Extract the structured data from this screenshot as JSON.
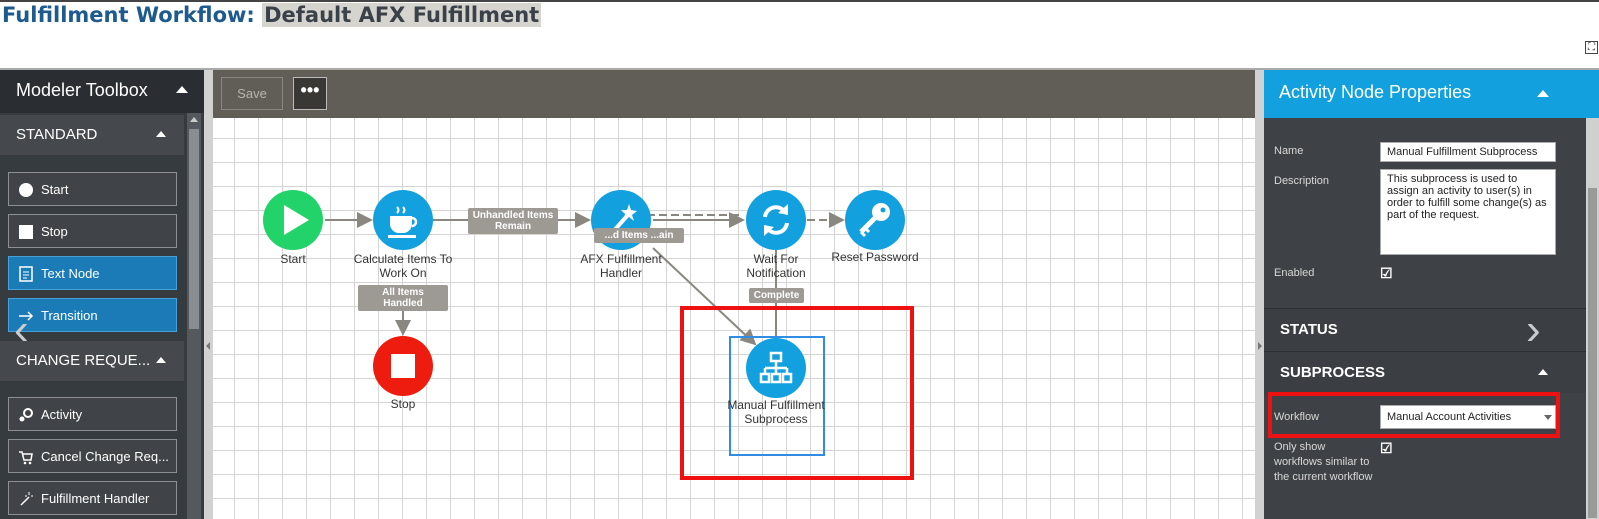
{
  "page": {
    "title_prefix": "Fulfillment Workflow:",
    "workflow_name": "Default AFX Fulfillment",
    "expand_glyph": "⛶"
  },
  "toolbox": {
    "title": "Modeler Toolbox",
    "sections": [
      {
        "label": "STANDARD",
        "items": [
          {
            "label": "Start",
            "icon": "circle-icon"
          },
          {
            "label": "Stop",
            "icon": "square-icon"
          },
          {
            "label": "Text Node",
            "icon": "document-icon"
          },
          {
            "label": "Transition",
            "icon": "arrow-right-icon"
          }
        ]
      },
      {
        "label": "CHANGE REQUE...",
        "items": [
          {
            "label": "Activity",
            "icon": "gears-icon"
          },
          {
            "label": "Cancel Change Req...",
            "icon": "cart-icon"
          },
          {
            "label": "Fulfillment Handler",
            "icon": "wand-icon"
          }
        ]
      }
    ]
  },
  "canvas_toolbar": {
    "save_label": "Save",
    "more_label": "•••"
  },
  "diagram": {
    "nodes": [
      {
        "id": "start",
        "label": "Start",
        "icon": "play-icon",
        "color": "#22d36a"
      },
      {
        "id": "calc",
        "label": "Calculate Items To Work On",
        "icon": "coffee-icon",
        "color": "#13a0df"
      },
      {
        "id": "afx",
        "label": "AFX Fulfillment Handler",
        "icon": "wand-icon",
        "color": "#13a0df"
      },
      {
        "id": "wait",
        "label": "Wait For Notification",
        "icon": "refresh-icon",
        "color": "#13a0df"
      },
      {
        "id": "reset",
        "label": "Reset Password",
        "icon": "key-icon",
        "color": "#13a0df"
      },
      {
        "id": "stop",
        "label": "Stop",
        "icon": "stop-icon",
        "color": "#ee1c0e"
      },
      {
        "id": "manual",
        "label": "Manual Fulfillment Subprocess",
        "icon": "hierarchy-icon",
        "color": "#13a0df"
      }
    ],
    "edge_labels": {
      "unhandled": "Unhandled Items Remain",
      "unhandled_2": "...d Items ...ain",
      "all_handled": "All Items Handled",
      "complete": "Complete"
    }
  },
  "properties": {
    "title": "Activity Node Properties",
    "name_label": "Name",
    "name_value": "Manual Fulfillment Subprocess",
    "description_label": "Description",
    "description_value": "This subprocess is used to assign an activity to user(s) in order to fulfill some change(s) as part of the request.",
    "enabled_label": "Enabled",
    "enabled": true,
    "status_section": "STATUS",
    "subprocess_section": "SUBPROCESS",
    "workflow_label": "Workflow",
    "workflow_value": "Manual Account Activities",
    "only_show_label": "Only show workflows similar to the current workflow",
    "only_show": true,
    "checkmark": "☑"
  },
  "colors": {
    "accent_blue": "#13a0df",
    "highlight_red": "#ee1111",
    "start_green": "#22d36a",
    "stop_red": "#ee1c0e"
  }
}
